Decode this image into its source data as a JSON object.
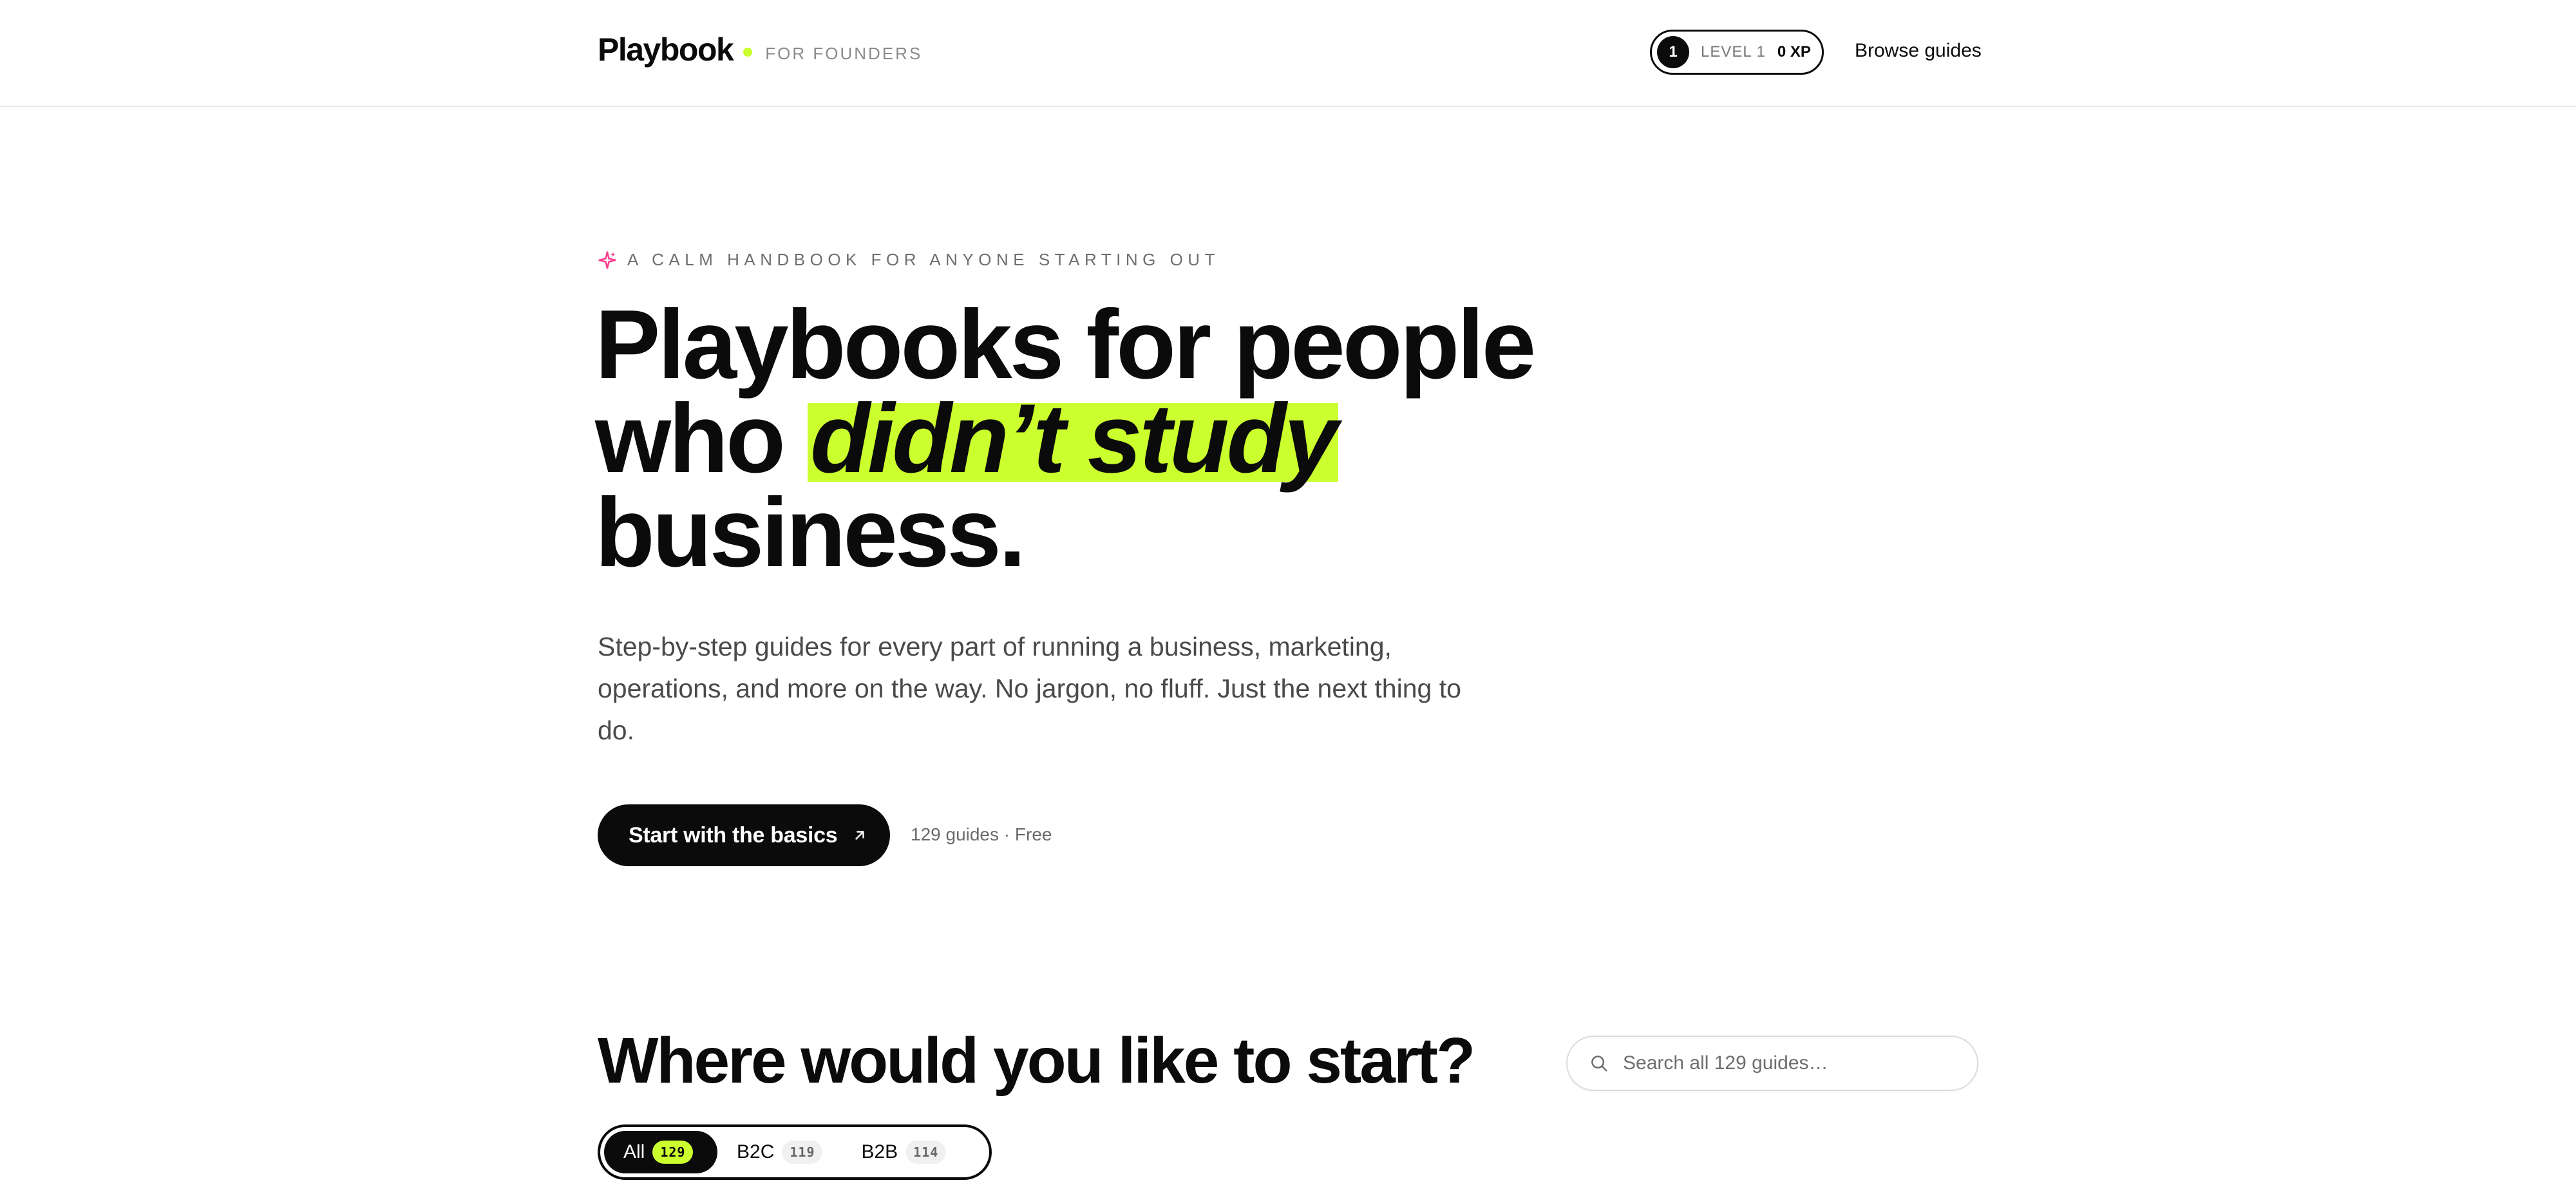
{
  "header": {
    "brand": "Playbook",
    "tagline": "FOR FOUNDERS",
    "level_number": "1",
    "level_label": "LEVEL 1",
    "xp": "0 XP",
    "browse": "Browse guides"
  },
  "hero": {
    "eyebrow": "A CALM HANDBOOK FOR ANYONE STARTING OUT",
    "title_line1": "Playbooks for people",
    "title_line2_pre": "who ",
    "title_highlight": "didn’t study",
    "title_line3": "business.",
    "subtitle": "Step-by-step guides for every part of running a business, marketing, operations, and more on the way. No jargon, no fluff. Just the next thing to do.",
    "cta_label": "Start with the basics",
    "cta_meta": "129 guides · Free"
  },
  "start": {
    "title": "Where would you like to start?",
    "search_placeholder": "Search all 129 guides…",
    "filters": [
      {
        "label": "All",
        "count": "129"
      },
      {
        "label": "B2C",
        "count": "119"
      },
      {
        "label": "B2B",
        "count": "114"
      }
    ]
  },
  "colors": {
    "accent": "#ccff2e",
    "ink": "#0b0b0b",
    "sparkle": "#ff3d8b"
  },
  "icons": {
    "sparkle": "sparkle-icon",
    "arrow": "arrow-up-right-icon",
    "search": "search-icon"
  }
}
